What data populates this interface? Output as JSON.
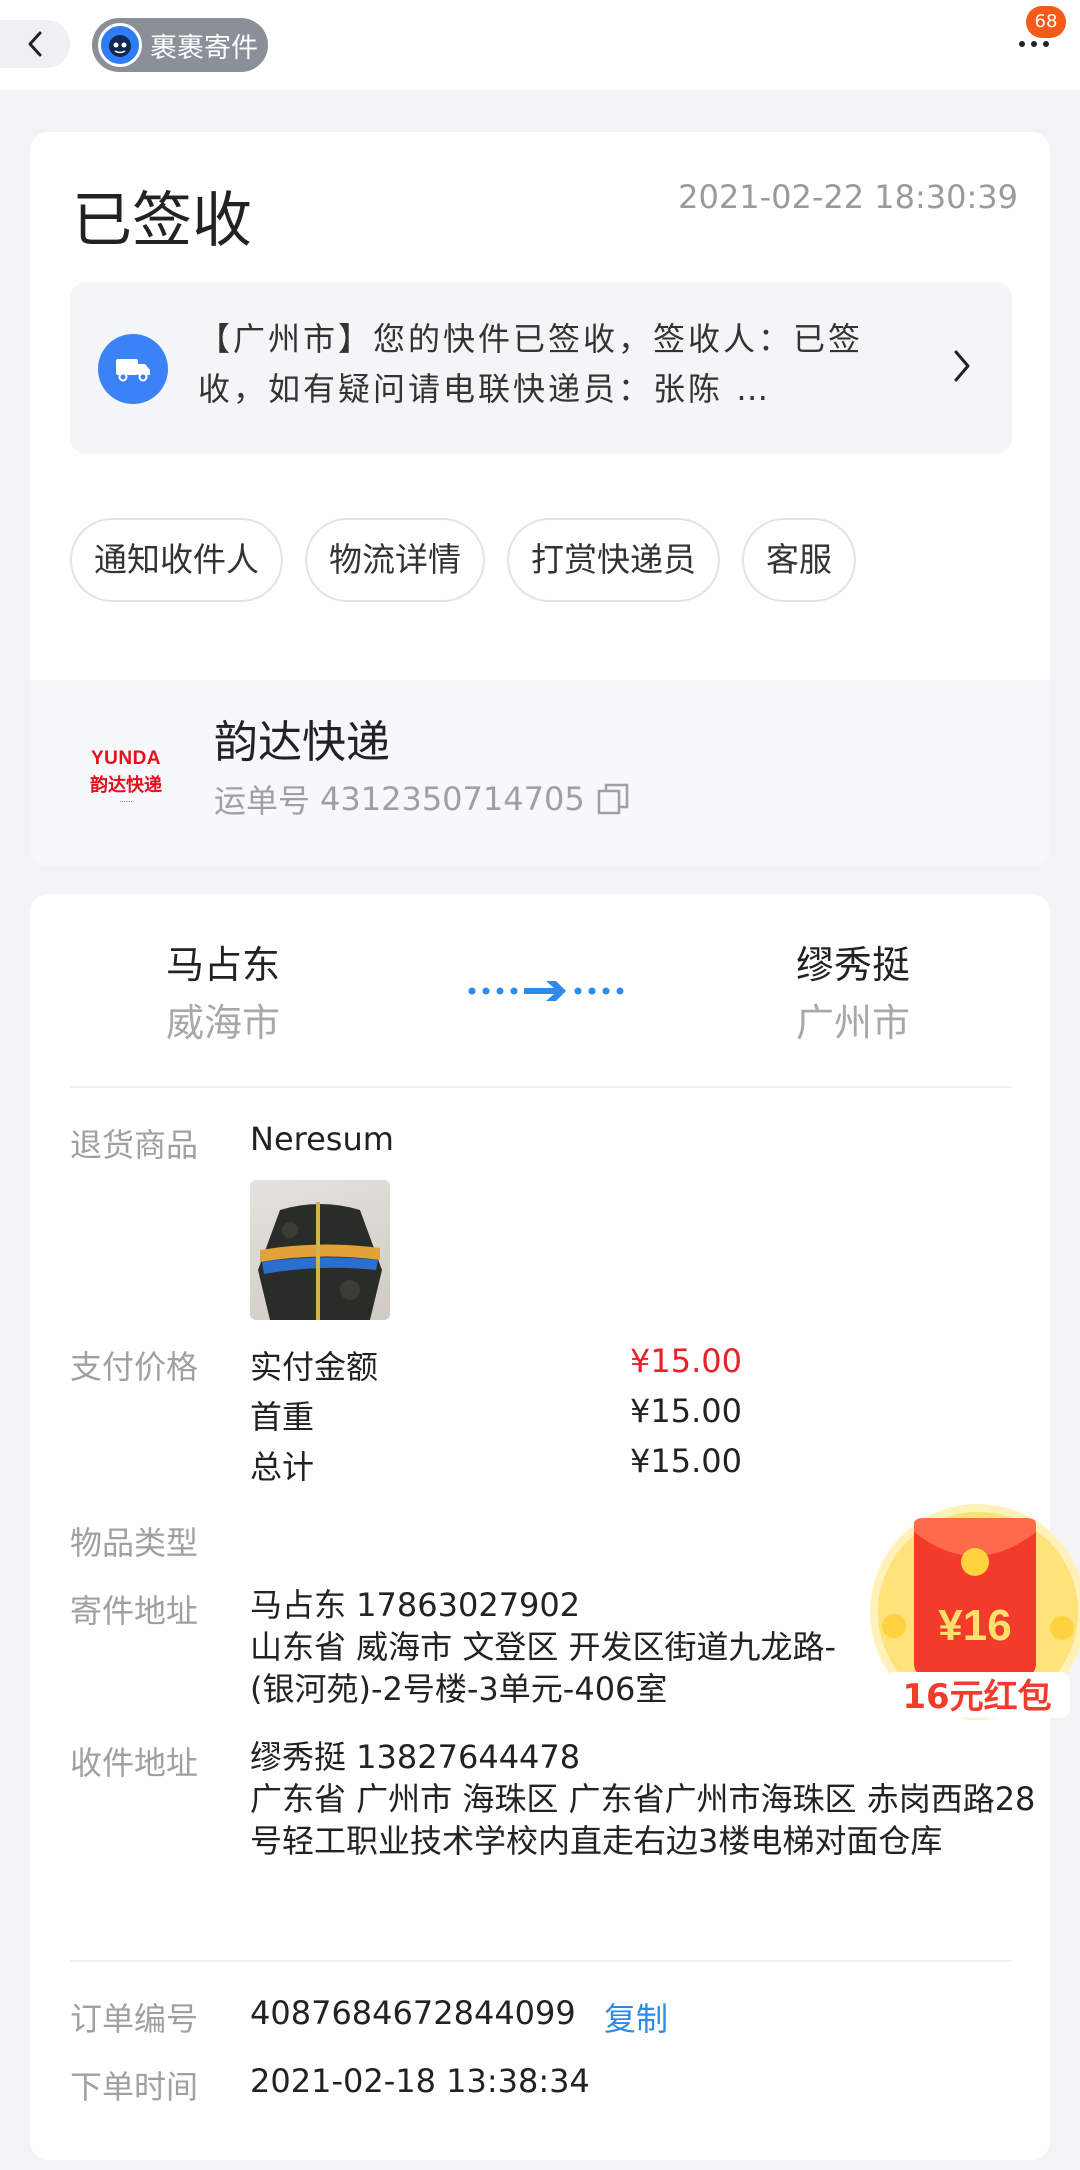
{
  "header": {
    "app_name": "裹裹寄件",
    "more_badge": "68"
  },
  "status": {
    "title": "已签收",
    "time": "2021-02-22 18:30:39",
    "latest_message": "【广州市】您的快件已签收，签收人：已签收，如有疑问请电联快递员：张陈 …"
  },
  "actions": [
    {
      "label": "通知收件人"
    },
    {
      "label": "物流详情"
    },
    {
      "label": "打赏快递员"
    },
    {
      "label": "客服"
    }
  ],
  "courier": {
    "logo_text": "YUNDA",
    "logo_cn": "韵达快递",
    "name": "韵达快递",
    "tracking_label": "运单号",
    "tracking_number": "4312350714705"
  },
  "route": {
    "sender_name": "马占东",
    "sender_city": "威海市",
    "receiver_name": "缪秀挺",
    "receiver_city": "广州市"
  },
  "details": {
    "product_label": "退货商品",
    "product_name": "Neresum",
    "price_label": "支付价格",
    "paid_label": "实付金额",
    "paid_value": "¥15.00",
    "first_weight_label": "首重",
    "first_weight_value": "¥15.00",
    "total_label": "总计",
    "total_value": "¥15.00",
    "item_type_label": "物品类型",
    "sender_addr_label": "寄件地址",
    "sender_contact": "马占东 17863027902",
    "sender_address": "山东省 威海市 文登区 开发区街道九龙路-(银河苑)-2号楼-3单元-406室",
    "receiver_addr_label": "收件地址",
    "receiver_contact": "缪秀挺 13827644478",
    "receiver_address": "广东省 广州市 海珠区 广东省广州市海珠区 赤岗西路28号轻工职业技术学校内直走右边3楼电梯对面仓库",
    "order_label": "订单编号",
    "order_number": "4087684672844099",
    "copy_label": "复制",
    "order_time_label": "下单时间",
    "order_time": "2021-02-18 13:38:34"
  },
  "red_packet": {
    "amount": "¥16",
    "label": "16元红包"
  },
  "colors": {
    "accent_blue": "#2e8ae6",
    "price_red": "#e8202a",
    "truck_blue": "#3b82f6",
    "brand_red": "#e4101c"
  }
}
